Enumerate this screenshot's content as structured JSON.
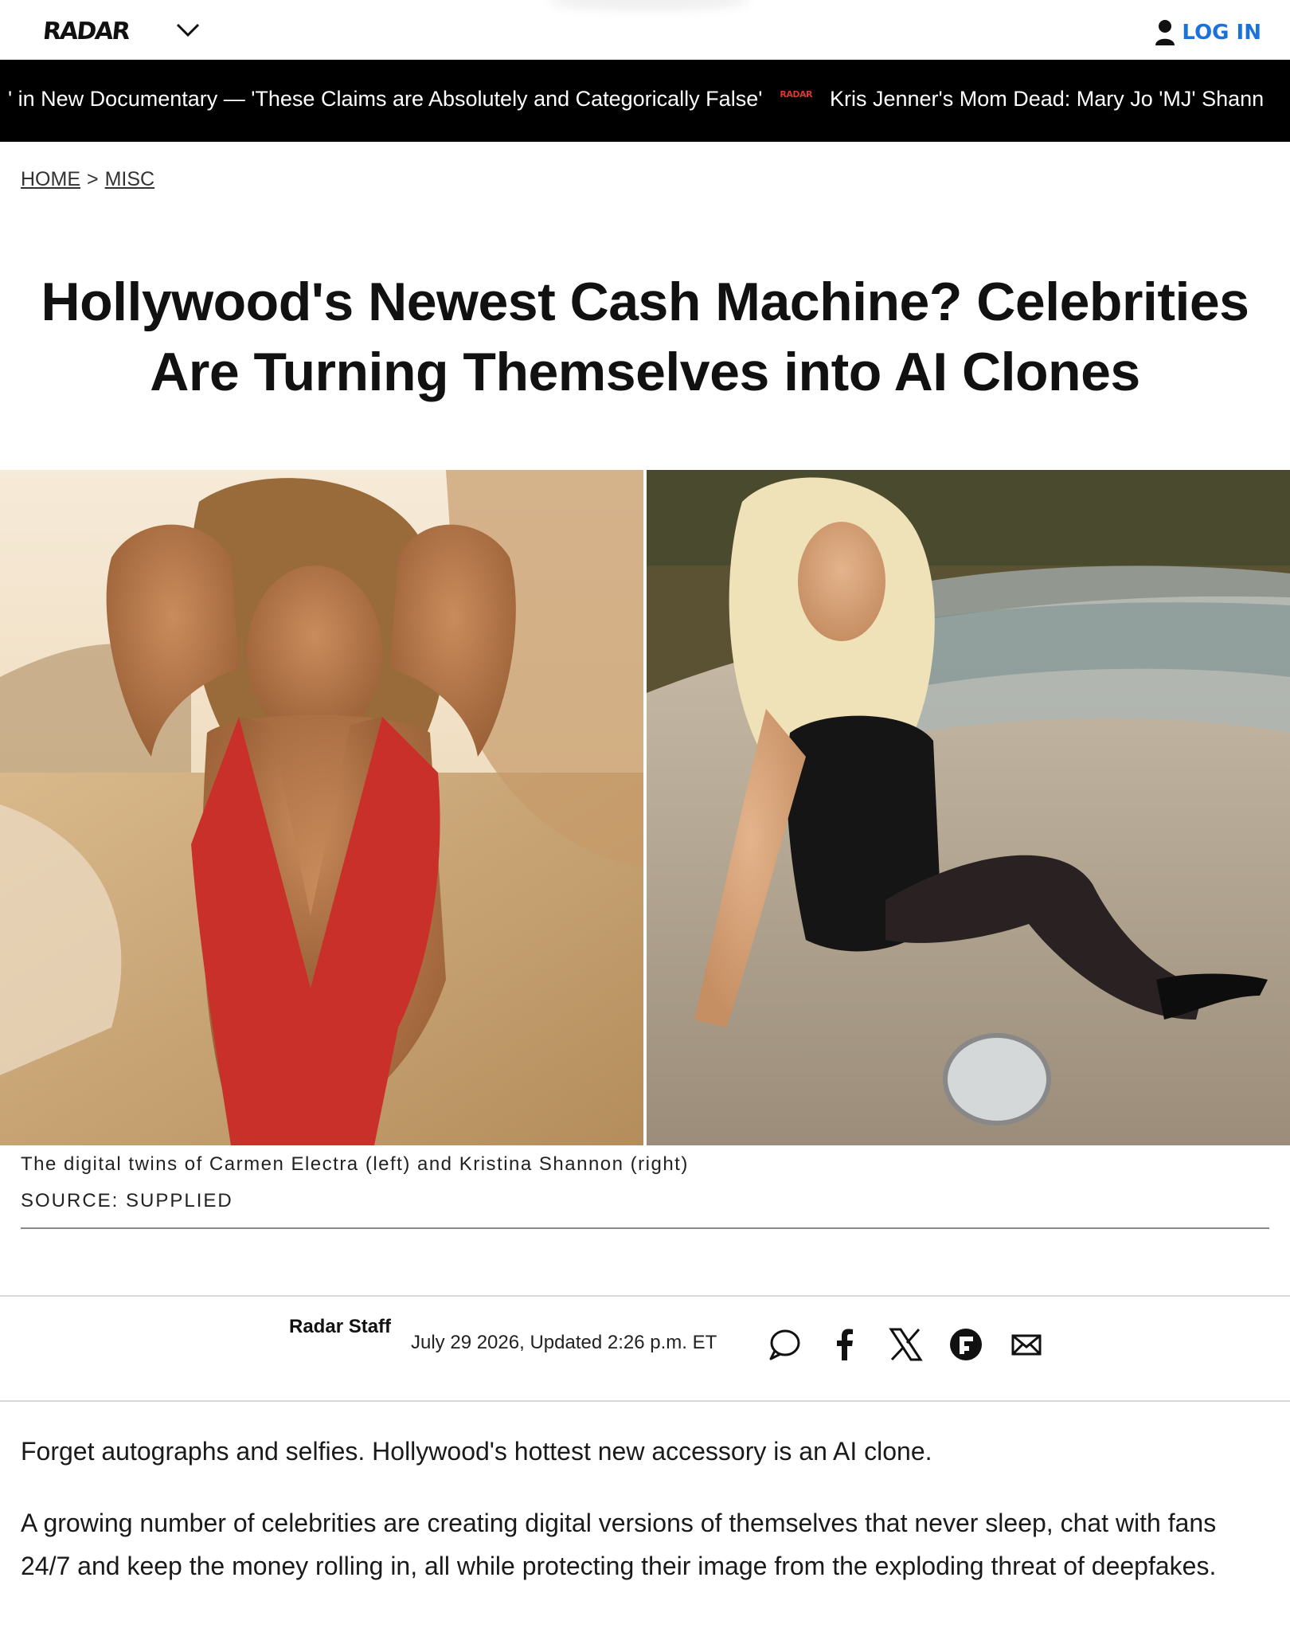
{
  "header": {
    "logo_text": "RADAR",
    "login_label": "LOG IN",
    "accent_color": "#1b73d9"
  },
  "ticker": {
    "items": [
      "' in New Documentary — 'These Claims are Absolutely and Categorically False'",
      "Kris Jenner's Mom Dead: Mary Jo 'MJ' Shann"
    ],
    "separator_text": "RADAR",
    "separator_color": "#e0342f"
  },
  "breadcrumb": {
    "home": "HOME",
    "separator": ">",
    "section": "MISC"
  },
  "article": {
    "title": "Hollywood's Newest Cash Machine? Celebrities Are Turning Themselves into AI Clones",
    "image_caption": "The digital twins of Carmen Electra (left) and Kristina Shannon (right)",
    "image_source": "SOURCE: SUPPLIED",
    "author": "Radar Staff",
    "date": "July 29 2026, Updated 2:26 p.m. ET",
    "paragraphs": [
      "Forget autographs and selfies. Hollywood's hottest new accessory is an AI clone.",
      "A growing number of celebrities are creating digital versions of themselves that never sleep, chat with fans 24/7 and keep the money rolling in, all while protecting their image from the exploding threat of deepfakes."
    ]
  },
  "share_icons": [
    "comment-icon",
    "facebook-icon",
    "x-icon",
    "flipboard-icon",
    "email-icon"
  ]
}
